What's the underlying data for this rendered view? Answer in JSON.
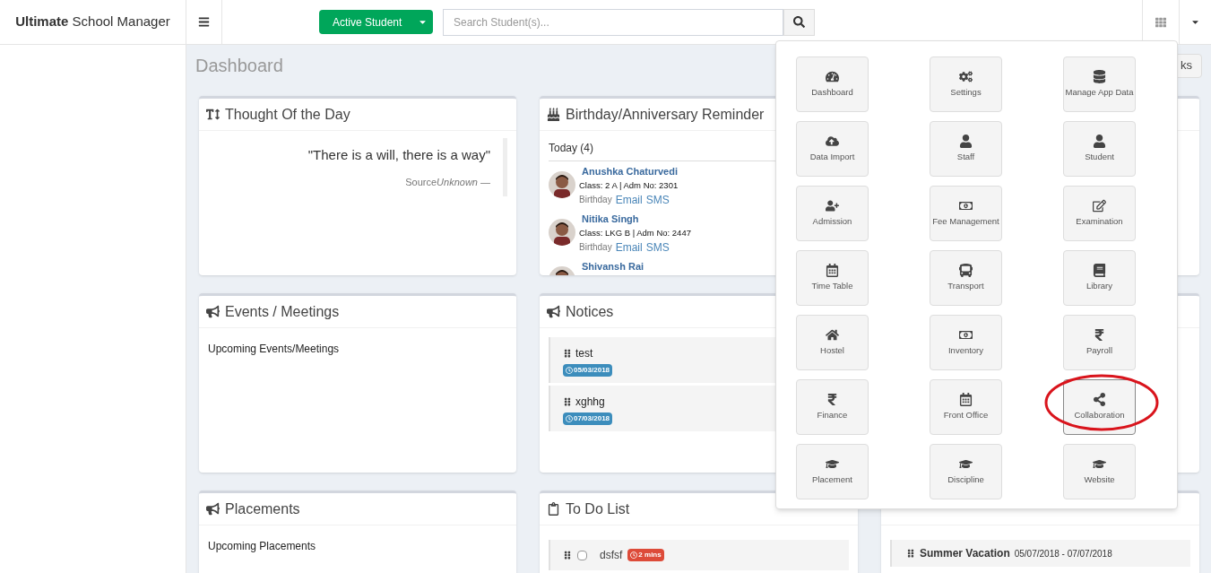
{
  "brand": "**Ultimate** School Manager",
  "topbar": {
    "student_filter": "Active Student",
    "search": {
      "placeholder": "Search Student(s)..."
    }
  },
  "page_title": "Dashboard",
  "quick_links_button": "ks",
  "thought": {
    "title": "Thought Of the Day",
    "quote": "\"There is a will, there is a way\"",
    "source_label": "Source",
    "source": "Unknown —"
  },
  "birthdays": {
    "title": "Birthday/Anniversary Reminder",
    "group": "Today (4)",
    "people": [
      {
        "name": "Anushka Chaturvedi",
        "details": "Class: 2 A | Adm No: 2301",
        "event": "Birthday",
        "links": [
          "Email",
          "SMS"
        ]
      },
      {
        "name": "Nitika Singh",
        "details": "Class: LKG B | Adm No: 2447",
        "event": "Birthday",
        "links": [
          "Email",
          "SMS"
        ]
      },
      {
        "name": "Shivansh Rai"
      }
    ]
  },
  "events": {
    "title": "Events / Meetings",
    "text": "Upcoming Events/Meetings"
  },
  "notices": {
    "title": "Notices",
    "items": [
      {
        "title": "test",
        "date": "05/03/2018"
      },
      {
        "title": "xghhg",
        "date": "07/03/2018"
      }
    ]
  },
  "placements": {
    "title": "Placements",
    "text": "Upcoming Placements"
  },
  "todo": {
    "title": "To Do List",
    "items": [
      {
        "text": "dsfsf",
        "checked": false,
        "age": "2 mins"
      }
    ]
  },
  "holidays": {
    "items": [
      {
        "name": "Summer Vacation",
        "dates": "05/07/2018 - 07/07/2018"
      }
    ]
  },
  "app_menu": {
    "items": [
      {
        "label": "Dashboard",
        "highlighted": false
      },
      {
        "label": "Settings",
        "highlighted": false
      },
      {
        "label": "Manage App Data",
        "highlighted": false
      },
      {
        "label": "Data Import",
        "highlighted": false
      },
      {
        "label": "Staff",
        "highlighted": false
      },
      {
        "label": "Student",
        "highlighted": false
      },
      {
        "label": "Admission",
        "highlighted": false
      },
      {
        "label": "Fee Management",
        "highlighted": false
      },
      {
        "label": "Examination",
        "highlighted": false
      },
      {
        "label": "Time Table",
        "highlighted": false
      },
      {
        "label": "Transport",
        "highlighted": false
      },
      {
        "label": "Library",
        "highlighted": false
      },
      {
        "label": "Hostel",
        "highlighted": false
      },
      {
        "label": "Inventory",
        "highlighted": false
      },
      {
        "label": "Payroll",
        "highlighted": false
      },
      {
        "label": "Finance",
        "highlighted": false
      },
      {
        "label": "Front Office",
        "highlighted": false
      },
      {
        "label": "Collaboration",
        "highlighted": true
      },
      {
        "label": "Placement",
        "highlighted": false
      },
      {
        "label": "Discipline",
        "highlighted": false
      },
      {
        "label": "Website",
        "highlighted": false
      }
    ]
  }
}
